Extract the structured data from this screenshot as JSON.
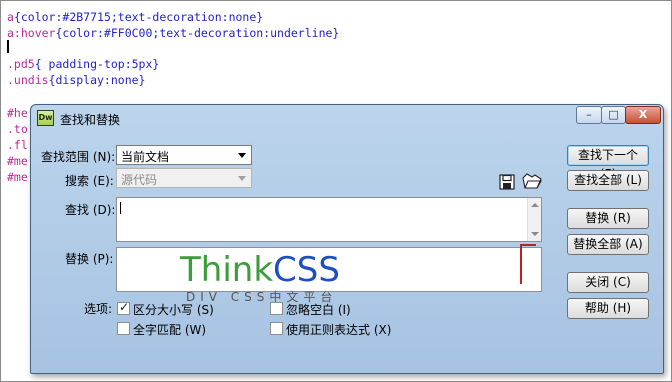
{
  "editor": {
    "lines": [
      {
        "sel": "a",
        "body": "{color:#2B7715;text-decoration:none}"
      },
      {
        "sel": "a:hover",
        "body": "{color:#FF0C00;text-decoration:underline}"
      },
      {
        "sel": ".pd5",
        "body": "{ padding-top:5px}"
      },
      {
        "sel": ".undis",
        "body": "{display:none}"
      }
    ],
    "truncated": [
      "#he",
      ".to",
      ".fl",
      "#me",
      "#me"
    ]
  },
  "dialog": {
    "title": "查找和替换",
    "app_icon": "Dw",
    "find_in_label": "查找范围 (N):",
    "find_in_value": "当前文档",
    "search_label": "搜索 (E):",
    "search_value": "源代码",
    "find_label": "查找 (D):",
    "find_value": "",
    "replace_label": "替换 (P):",
    "replace_value": "",
    "options_label": "选项:",
    "options": {
      "match_case": {
        "label": "区分大小写 (S)",
        "checked": true
      },
      "ignore_whitespace": {
        "label": "忽略空白 (I)",
        "checked": false
      },
      "match_whole_word": {
        "label": "全字匹配 (W)",
        "checked": false
      },
      "use_regex": {
        "label": "使用正则表达式 (X)",
        "checked": false
      }
    },
    "buttons": {
      "find_next": "查找下一个 (F)",
      "find_all": "查找全部 (L)",
      "replace": "替换 (R)",
      "replace_all": "替换全部 (A)",
      "close": "关闭 (C)",
      "help": "帮助 (H)"
    },
    "window_buttons": {
      "minimize": "–",
      "maximize": "□",
      "close": "X"
    },
    "icons": {
      "save": "save-query-icon",
      "open": "load-query-icon"
    }
  },
  "watermark": {
    "think": "Think",
    "css": "CSS",
    "sub": "DIV CSS中文平台",
    "colors": {
      "think": "#3a9d3a",
      "css": "#1e4fbf"
    }
  }
}
